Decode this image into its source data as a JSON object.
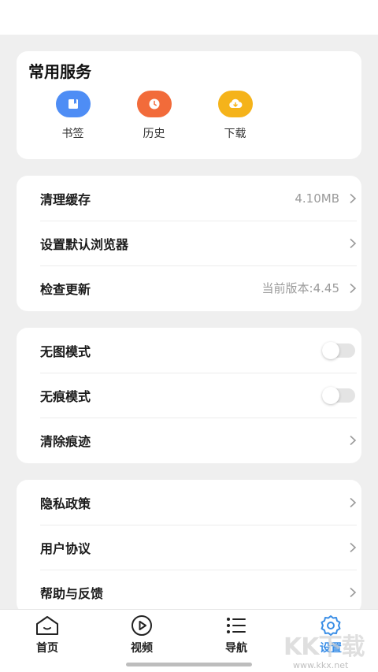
{
  "services": {
    "title": "常用服务",
    "items": [
      {
        "label": "书签",
        "icon": "bookmark-icon",
        "color": "#4e8df5"
      },
      {
        "label": "历史",
        "icon": "clock-icon",
        "color": "#f26b3a"
      },
      {
        "label": "下载",
        "icon": "download-icon",
        "color": "#f5b31a"
      }
    ]
  },
  "general": {
    "clear_cache": {
      "label": "清理缓存",
      "value": "4.10MB"
    },
    "default_browser": {
      "label": "设置默认浏览器"
    },
    "check_update": {
      "label": "检查更新",
      "value": "当前版本:4.45"
    }
  },
  "modes": {
    "no_image": {
      "label": "无图模式",
      "enabled": false
    },
    "incognito": {
      "label": "无痕模式",
      "enabled": false
    },
    "clear_traces": {
      "label": "清除痕迹"
    }
  },
  "about": {
    "privacy_policy": {
      "label": "隐私政策"
    },
    "user_agreement": {
      "label": "用户协议"
    },
    "help_feedback": {
      "label": "帮助与反馈"
    }
  },
  "tabbar": {
    "items": [
      {
        "label": "首页",
        "icon": "home-icon"
      },
      {
        "label": "视频",
        "icon": "play-icon"
      },
      {
        "label": "导航",
        "icon": "list-icon"
      },
      {
        "label": "设置",
        "icon": "gear-icon",
        "active": true
      }
    ],
    "active_color": "#3a8ee6"
  },
  "watermark": {
    "text": "KK下载",
    "url": "www.kkx.net"
  }
}
